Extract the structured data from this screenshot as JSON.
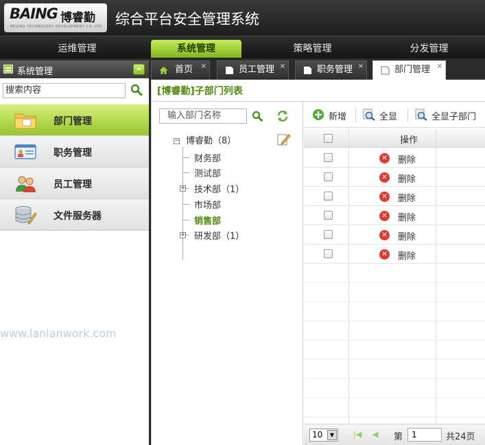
{
  "header": {
    "logo_text": "BAING",
    "logo_cn": "博睿勤",
    "logo_tagline": "BEIJING TECHNOLOGY DEVELOPMENT CO.,LTD",
    "app_title": "综合平台安全管理系统"
  },
  "topnav": {
    "items": [
      {
        "label": "运维管理"
      },
      {
        "label": "系统管理",
        "active": true
      },
      {
        "label": "策略管理"
      },
      {
        "label": "分发管理"
      }
    ]
  },
  "sidebar": {
    "title": "系统管理",
    "search_value": "搜索内容",
    "items": [
      {
        "label": "部门管理",
        "icon": "folder-icon",
        "active": true
      },
      {
        "label": "职务管理",
        "icon": "id-card-icon"
      },
      {
        "label": "员工管理",
        "icon": "users-icon"
      },
      {
        "label": "文件服务器",
        "icon": "database-icon"
      }
    ],
    "watermark": "www.lanlanwork.com"
  },
  "tabs": [
    {
      "label": "首页",
      "icon": "home-icon"
    },
    {
      "label": "员工管理",
      "icon": "page-icon"
    },
    {
      "label": "职务管理",
      "icon": "page-icon"
    },
    {
      "label": "部门管理",
      "icon": "page-icon",
      "active": true
    }
  ],
  "main": {
    "title": "[博睿勤]子部门列表",
    "dept_search_placeholder": "输入部门名称",
    "tree": {
      "root": "博睿勤（8）",
      "children": [
        {
          "label": "财务部"
        },
        {
          "label": "测试部"
        },
        {
          "label": "技术部（1）",
          "expandable": true
        },
        {
          "label": "市场部"
        },
        {
          "label": "销售部",
          "selected": true
        },
        {
          "label": "研发部（1）",
          "expandable": true
        }
      ]
    },
    "toolbar": {
      "add_label": "新增",
      "show_all_label": "全显",
      "show_all_children_label": "全显子部门"
    },
    "grid": {
      "col_operation": "操作",
      "rows": [
        {
          "action": "删除"
        },
        {
          "action": "删除"
        },
        {
          "action": "删除"
        },
        {
          "action": "删除"
        },
        {
          "action": "删除"
        },
        {
          "action": "删除"
        }
      ]
    },
    "pager": {
      "page_size": "10",
      "page_label": "第",
      "page_value": "1",
      "total_label": "共24页"
    }
  },
  "colors": {
    "accent_green": "#8cbf24",
    "title_green": "#4f8a10",
    "delete_red": "#e03a2c"
  }
}
